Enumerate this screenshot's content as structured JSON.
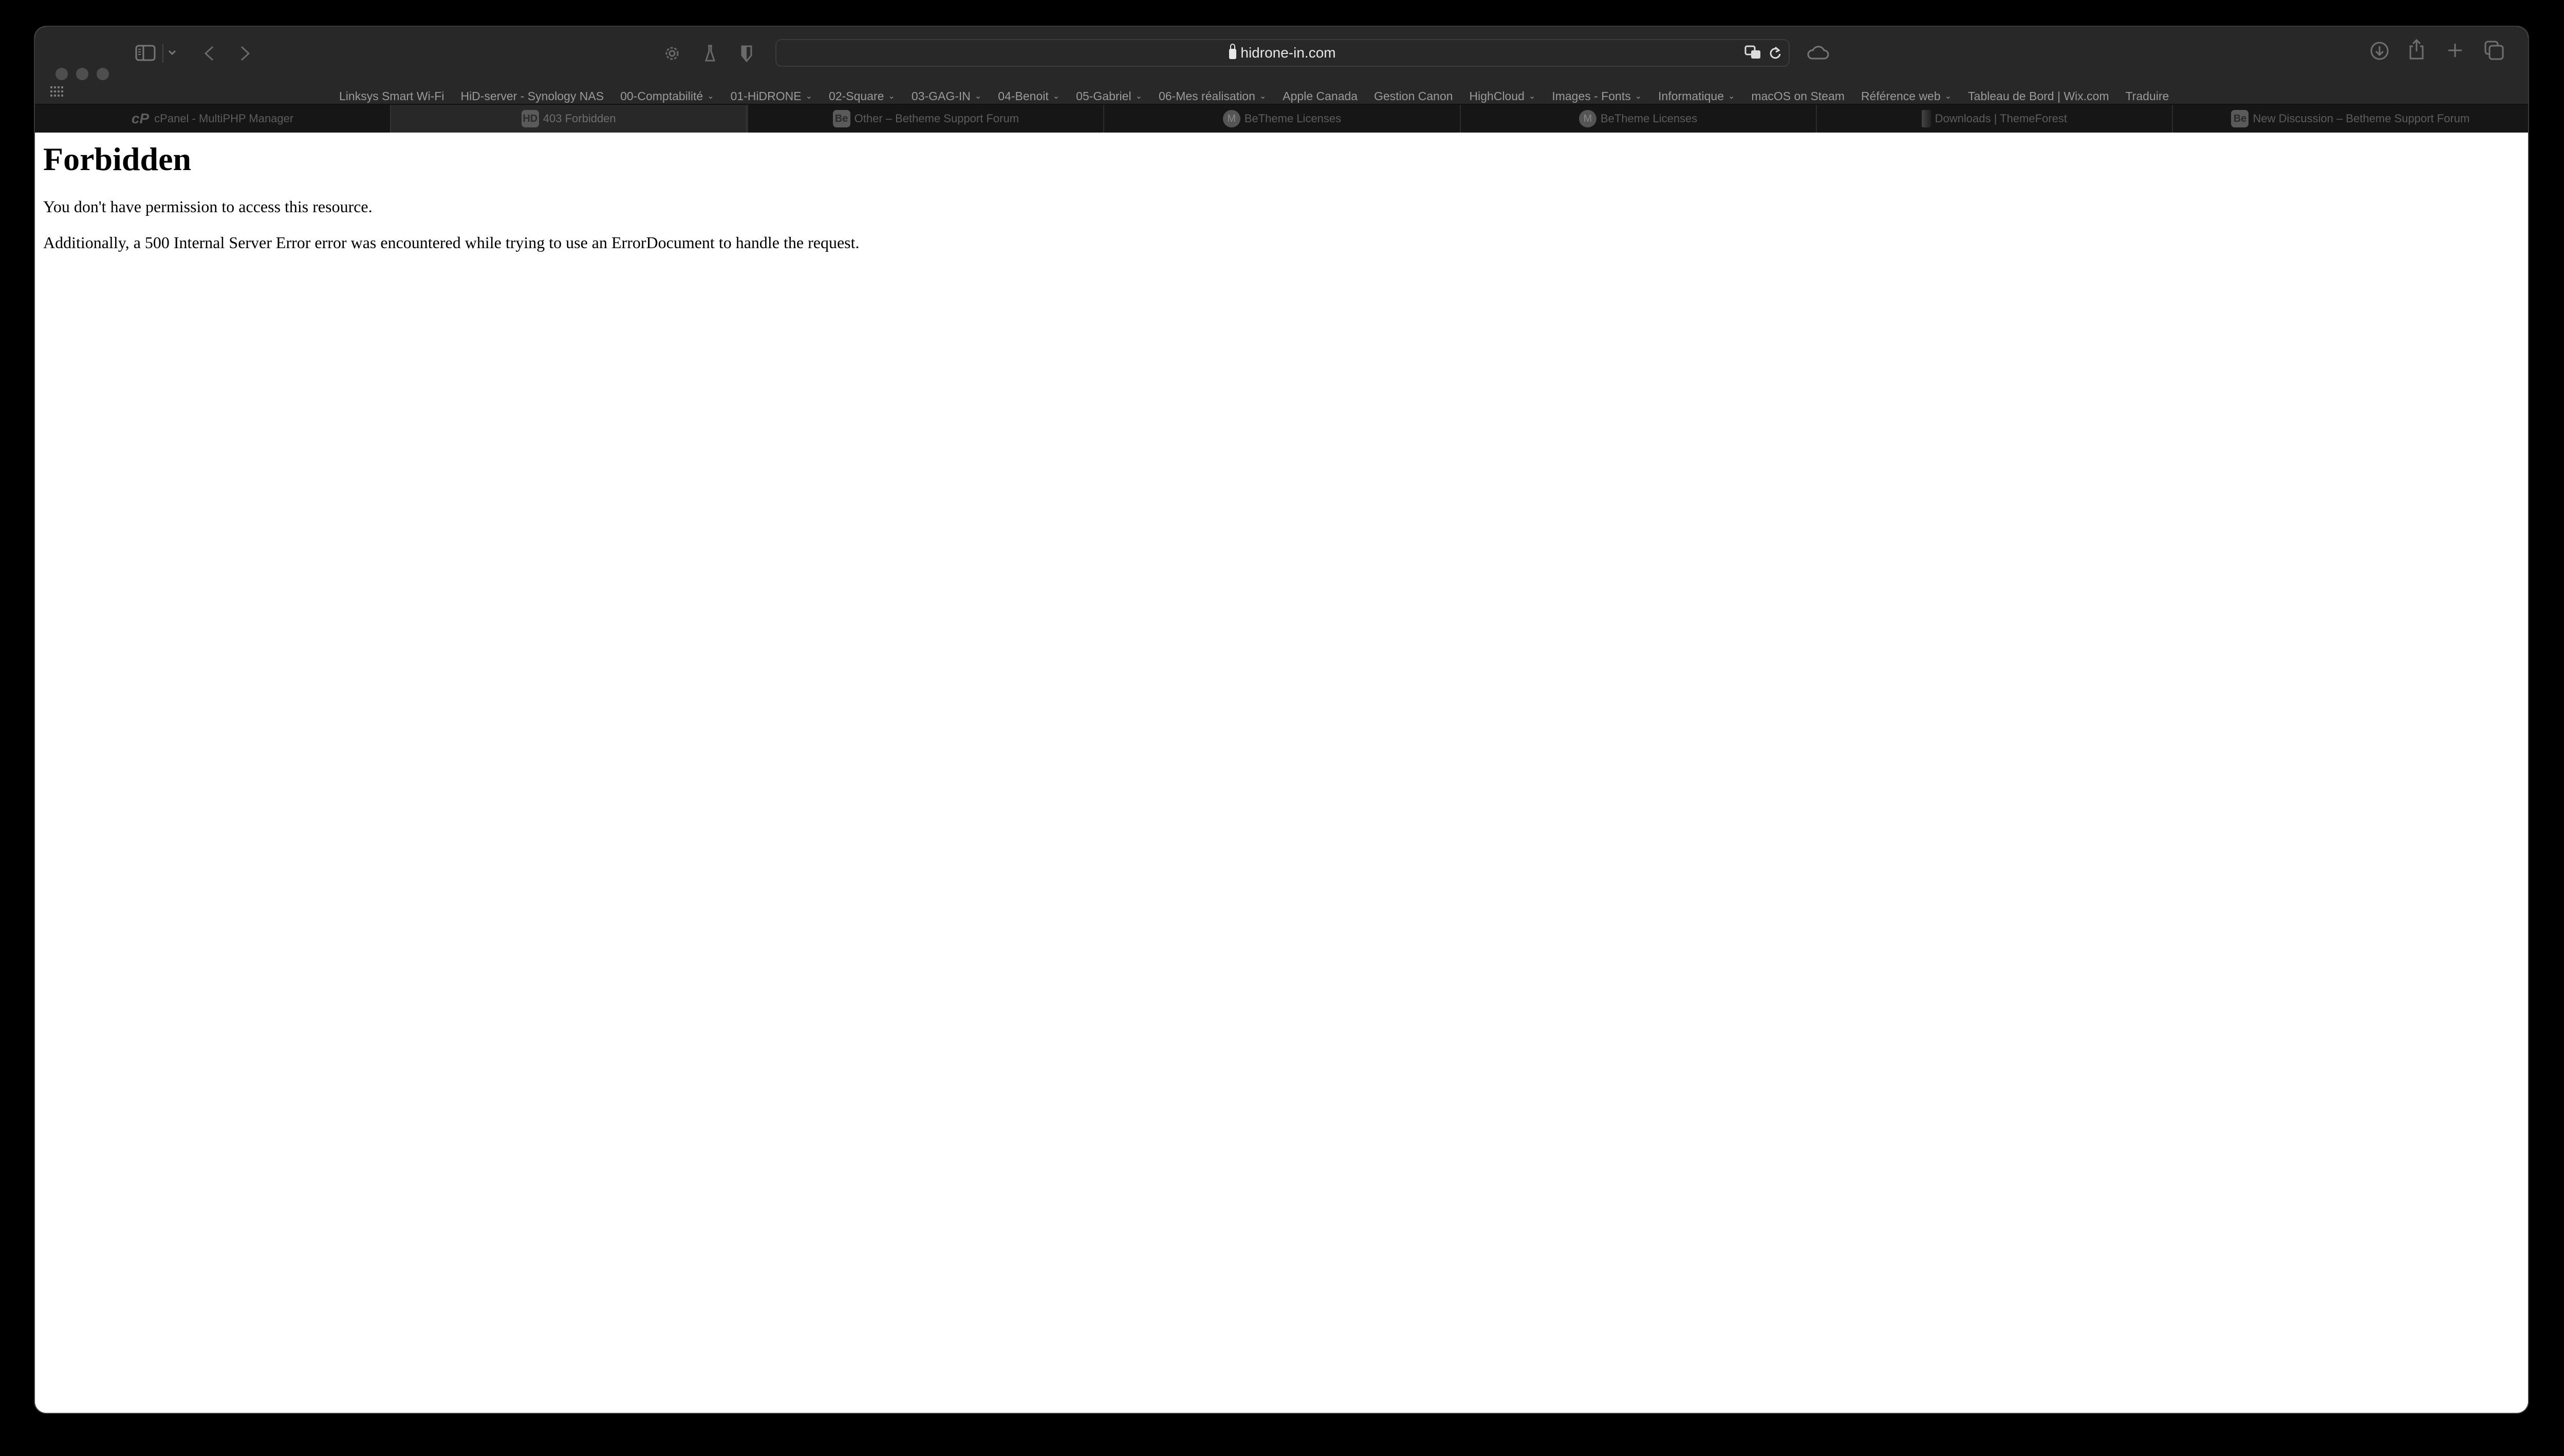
{
  "browser": {
    "address_bar": {
      "url": "hidrone-in.com"
    },
    "bookmarks": [
      {
        "label": "Linksys Smart Wi-Fi",
        "folder": false
      },
      {
        "label": "HiD-server - Synology NAS",
        "folder": false
      },
      {
        "label": "00-Comptabilité",
        "folder": true
      },
      {
        "label": "01-HiDRONE",
        "folder": true
      },
      {
        "label": "02-Square",
        "folder": true
      },
      {
        "label": "03-GAG-IN",
        "folder": true
      },
      {
        "label": "04-Benoit",
        "folder": true
      },
      {
        "label": "05-Gabriel",
        "folder": true
      },
      {
        "label": "06-Mes réalisation",
        "folder": true
      },
      {
        "label": "Apple Canada",
        "folder": false
      },
      {
        "label": "Gestion Canon",
        "folder": false
      },
      {
        "label": "HighCloud",
        "folder": true
      },
      {
        "label": "Images - Fonts",
        "folder": true
      },
      {
        "label": "Informatique",
        "folder": true
      },
      {
        "label": "macOS on Steam",
        "folder": false
      },
      {
        "label": "Référence web",
        "folder": true
      },
      {
        "label": "Tableau de Bord | Wix.com",
        "folder": false
      },
      {
        "label": "Traduire",
        "folder": false
      }
    ],
    "tabs": [
      {
        "title": "cPanel - MultiPHP Manager",
        "favicon": "cP",
        "active": false
      },
      {
        "title": "403 Forbidden",
        "favicon": "HD",
        "active": true
      },
      {
        "title": "Other – Betheme Support Forum",
        "favicon": "Be",
        "active": false
      },
      {
        "title": "BeTheme Licenses",
        "favicon": "M",
        "active": false
      },
      {
        "title": "BeTheme Licenses",
        "favicon": "M",
        "active": false
      },
      {
        "title": "Downloads | ThemeForest",
        "favicon": "",
        "active": false
      },
      {
        "title": "New Discussion – Betheme Support Forum",
        "favicon": "Be",
        "active": false
      }
    ]
  },
  "page": {
    "heading": "Forbidden",
    "message": "You don't have permission to access this resource.",
    "detail": "Additionally, a 500 Internal Server Error error was encountered while trying to use an ErrorDocument to handle the request."
  }
}
